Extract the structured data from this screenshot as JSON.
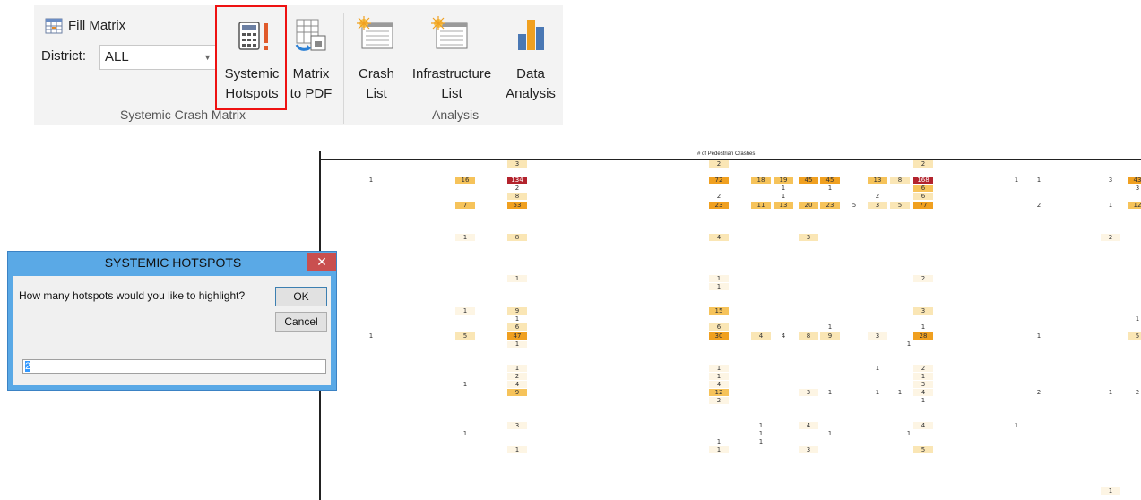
{
  "ribbon": {
    "fill_matrix_label": "Fill Matrix",
    "district_label": "District:",
    "district_value": "ALL",
    "buttons": {
      "systemic_hotspots": [
        "Systemic",
        "Hotspots"
      ],
      "matrix_to_pdf": [
        "Matrix",
        "to PDF"
      ],
      "crash_list": [
        "Crash",
        "List"
      ],
      "infrastructure_list": [
        "Infrastructure",
        "List"
      ],
      "data_analysis": [
        "Data",
        "Analysis"
      ]
    },
    "groups": {
      "systemic_crash_matrix": "Systemic Crash Matrix",
      "analysis": "Analysis"
    }
  },
  "sheet": {
    "title": "# of Pedestrian Crashes",
    "colors": {
      "high": "#b3232d",
      "orange": "#f0a020",
      "mid": "#f6c35a",
      "light": "#fae6b5",
      "faint": "#fdf5e4"
    },
    "cells": [
      {
        "text": "3",
        "color": "light",
        "col": 0,
        "row": 0
      },
      {
        "text": "2",
        "color": "light",
        "col": 1,
        "row": 0
      },
      {
        "text": "2",
        "color": "light",
        "col": 2,
        "row": 0
      },
      {
        "text": "1",
        "color": "none",
        "col": 3,
        "row": 2
      },
      {
        "text": "16",
        "color": "mid",
        "col": 4,
        "row": 2
      },
      {
        "text": "134",
        "color": "high",
        "col": 0,
        "row": 2
      },
      {
        "text": "72",
        "color": "orange",
        "col": 1,
        "row": 2
      },
      {
        "text": "18",
        "color": "mid",
        "col": 5,
        "row": 2
      },
      {
        "text": "19",
        "color": "mid",
        "col": 6,
        "row": 2
      },
      {
        "text": "45",
        "color": "orange",
        "col": 7,
        "row": 2
      },
      {
        "text": "45",
        "color": "orange",
        "col": 8,
        "row": 2
      },
      {
        "text": "13",
        "color": "mid",
        "col": 9,
        "row": 2
      },
      {
        "text": "8",
        "color": "light",
        "col": 10,
        "row": 2
      },
      {
        "text": "168",
        "color": "high",
        "col": 2,
        "row": 2
      },
      {
        "text": "1",
        "color": "none",
        "col": 11,
        "row": 2
      },
      {
        "text": "1",
        "color": "none",
        "col": 12,
        "row": 2
      },
      {
        "text": "3",
        "color": "none",
        "col": 13,
        "row": 2
      },
      {
        "text": "43",
        "color": "orange",
        "col": 14,
        "row": 2
      },
      {
        "text": "2",
        "color": "none",
        "col": 0,
        "row": 3
      },
      {
        "text": "1",
        "color": "none",
        "col": 6,
        "row": 3
      },
      {
        "text": "1",
        "color": "none",
        "col": 8,
        "row": 3
      },
      {
        "text": "6",
        "color": "mid",
        "col": 2,
        "row": 3
      },
      {
        "text": "3",
        "color": "none",
        "col": 14,
        "row": 3
      },
      {
        "text": "8",
        "color": "light",
        "col": 0,
        "row": 4
      },
      {
        "text": "2",
        "color": "none",
        "col": 1,
        "row": 4
      },
      {
        "text": "1",
        "color": "none",
        "col": 6,
        "row": 4
      },
      {
        "text": "2",
        "color": "none",
        "col": 9,
        "row": 4
      },
      {
        "text": "6",
        "color": "light",
        "col": 2,
        "row": 4
      },
      {
        "text": "7",
        "color": "mid",
        "col": 4,
        "row": 5
      },
      {
        "text": "53",
        "color": "orange",
        "col": 0,
        "row": 5
      },
      {
        "text": "23",
        "color": "orange",
        "col": 1,
        "row": 5
      },
      {
        "text": "11",
        "color": "mid",
        "col": 5,
        "row": 5
      },
      {
        "text": "13",
        "color": "mid",
        "col": 6,
        "row": 5
      },
      {
        "text": "20",
        "color": "mid",
        "col": 7,
        "row": 5
      },
      {
        "text": "23",
        "color": "mid",
        "col": 8,
        "row": 5
      },
      {
        "text": "5",
        "color": "none",
        "col": 15,
        "row": 5
      },
      {
        "text": "3",
        "color": "light",
        "col": 9,
        "row": 5
      },
      {
        "text": "5",
        "color": "light",
        "col": 10,
        "row": 5
      },
      {
        "text": "77",
        "color": "orange",
        "col": 2,
        "row": 5
      },
      {
        "text": "2",
        "color": "none",
        "col": 16,
        "row": 5
      },
      {
        "text": "1",
        "color": "none",
        "col": 13,
        "row": 5
      },
      {
        "text": "12",
        "color": "mid",
        "col": 14,
        "row": 5
      },
      {
        "text": "1",
        "color": "faint",
        "col": 4,
        "row": 9
      },
      {
        "text": "8",
        "color": "light",
        "col": 0,
        "row": 9
      },
      {
        "text": "4",
        "color": "light",
        "col": 1,
        "row": 9
      },
      {
        "text": "3",
        "color": "light",
        "col": 7,
        "row": 9
      },
      {
        "text": "2",
        "color": "faint",
        "col": 17,
        "row": 9
      },
      {
        "text": "1",
        "color": "faint",
        "col": 0,
        "row": 14
      },
      {
        "text": "1",
        "color": "faint",
        "col": 1,
        "row": 14
      },
      {
        "text": "2",
        "color": "faint",
        "col": 2,
        "row": 14
      },
      {
        "text": "1",
        "color": "faint",
        "col": 1,
        "row": 15
      },
      {
        "text": "1",
        "color": "faint",
        "col": 4,
        "row": 18
      },
      {
        "text": "9",
        "color": "light",
        "col": 0,
        "row": 18
      },
      {
        "text": "15",
        "color": "mid",
        "col": 1,
        "row": 18
      },
      {
        "text": "3",
        "color": "light",
        "col": 2,
        "row": 18
      },
      {
        "text": "1",
        "color": "none",
        "col": 0,
        "row": 19
      },
      {
        "text": "1",
        "color": "none",
        "col": 14,
        "row": 19
      },
      {
        "text": "6",
        "color": "light",
        "col": 0,
        "row": 20
      },
      {
        "text": "6",
        "color": "light",
        "col": 1,
        "row": 20
      },
      {
        "text": "1",
        "color": "none",
        "col": 8,
        "row": 20
      },
      {
        "text": "1",
        "color": "none",
        "col": 2,
        "row": 20
      },
      {
        "text": "1",
        "color": "none",
        "col": 3,
        "row": 21
      },
      {
        "text": "5",
        "color": "light",
        "col": 4,
        "row": 21
      },
      {
        "text": "47",
        "color": "orange",
        "col": 0,
        "row": 21
      },
      {
        "text": "30",
        "color": "orange",
        "col": 1,
        "row": 21
      },
      {
        "text": "4",
        "color": "light",
        "col": 5,
        "row": 21
      },
      {
        "text": "4",
        "color": "none",
        "col": 6,
        "row": 21
      },
      {
        "text": "8",
        "color": "light",
        "col": 7,
        "row": 21
      },
      {
        "text": "9",
        "color": "light",
        "col": 8,
        "row": 21
      },
      {
        "text": "3",
        "color": "faint",
        "col": 9,
        "row": 21
      },
      {
        "text": "28",
        "color": "orange",
        "col": 2,
        "row": 21
      },
      {
        "text": "1",
        "color": "none",
        "col": 12,
        "row": 21
      },
      {
        "text": "5",
        "color": "light",
        "col": 14,
        "row": 21
      },
      {
        "text": "1",
        "color": "faint",
        "col": 0,
        "row": 22
      },
      {
        "text": "1",
        "color": "none",
        "col": 18,
        "row": 22
      },
      {
        "text": "1",
        "color": "faint",
        "col": 0,
        "row": 25
      },
      {
        "text": "1",
        "color": "faint",
        "col": 1,
        "row": 25
      },
      {
        "text": "1",
        "color": "none",
        "col": 9,
        "row": 25
      },
      {
        "text": "2",
        "color": "faint",
        "col": 2,
        "row": 25
      },
      {
        "text": "2",
        "color": "faint",
        "col": 0,
        "row": 26
      },
      {
        "text": "1",
        "color": "faint",
        "col": 1,
        "row": 26
      },
      {
        "text": "1",
        "color": "faint",
        "col": 2,
        "row": 26
      },
      {
        "text": "1",
        "color": "none",
        "col": 4,
        "row": 27
      },
      {
        "text": "4",
        "color": "faint",
        "col": 0,
        "row": 27
      },
      {
        "text": "4",
        "color": "faint",
        "col": 1,
        "row": 27
      },
      {
        "text": "3",
        "color": "faint",
        "col": 2,
        "row": 27
      },
      {
        "text": "9",
        "color": "mid",
        "col": 0,
        "row": 28
      },
      {
        "text": "12",
        "color": "mid",
        "col": 1,
        "row": 28
      },
      {
        "text": "3",
        "color": "faint",
        "col": 7,
        "row": 28
      },
      {
        "text": "1",
        "color": "none",
        "col": 8,
        "row": 28
      },
      {
        "text": "1",
        "color": "none",
        "col": 9,
        "row": 28
      },
      {
        "text": "1",
        "color": "none",
        "col": 10,
        "row": 28
      },
      {
        "text": "4",
        "color": "faint",
        "col": 2,
        "row": 28
      },
      {
        "text": "2",
        "color": "none",
        "col": 16,
        "row": 28
      },
      {
        "text": "1",
        "color": "none",
        "col": 13,
        "row": 28
      },
      {
        "text": "2",
        "color": "none",
        "col": 14,
        "row": 28
      },
      {
        "text": "2",
        "color": "faint",
        "col": 1,
        "row": 29
      },
      {
        "text": "1",
        "color": "none",
        "col": 2,
        "row": 29
      },
      {
        "text": "3",
        "color": "faint",
        "col": 0,
        "row": 32
      },
      {
        "text": "1",
        "color": "none",
        "col": 5,
        "row": 32
      },
      {
        "text": "4",
        "color": "faint",
        "col": 7,
        "row": 32
      },
      {
        "text": "4",
        "color": "faint",
        "col": 2,
        "row": 32
      },
      {
        "text": "1",
        "color": "none",
        "col": 11,
        "row": 32
      },
      {
        "text": "1",
        "color": "none",
        "col": 4,
        "row": 33
      },
      {
        "text": "1",
        "color": "none",
        "col": 5,
        "row": 33
      },
      {
        "text": "1",
        "color": "none",
        "col": 8,
        "row": 33
      },
      {
        "text": "1",
        "color": "none",
        "col": 18,
        "row": 33
      },
      {
        "text": "1",
        "color": "none",
        "col": 1,
        "row": 34
      },
      {
        "text": "1",
        "color": "none",
        "col": 5,
        "row": 34
      },
      {
        "text": "1",
        "color": "faint",
        "col": 0,
        "row": 35
      },
      {
        "text": "1",
        "color": "faint",
        "col": 1,
        "row": 35
      },
      {
        "text": "3",
        "color": "faint",
        "col": 7,
        "row": 35
      },
      {
        "text": "5",
        "color": "light",
        "col": 2,
        "row": 35
      },
      {
        "text": "1",
        "color": "faint",
        "col": 13,
        "row": 40
      }
    ]
  },
  "dialog": {
    "title": "SYSTEMIC HOTSPOTS",
    "close_label": "✕",
    "prompt": "How many hotspots would you like to highlight?",
    "ok_label": "OK",
    "cancel_label": "Cancel",
    "input_value": "2"
  }
}
